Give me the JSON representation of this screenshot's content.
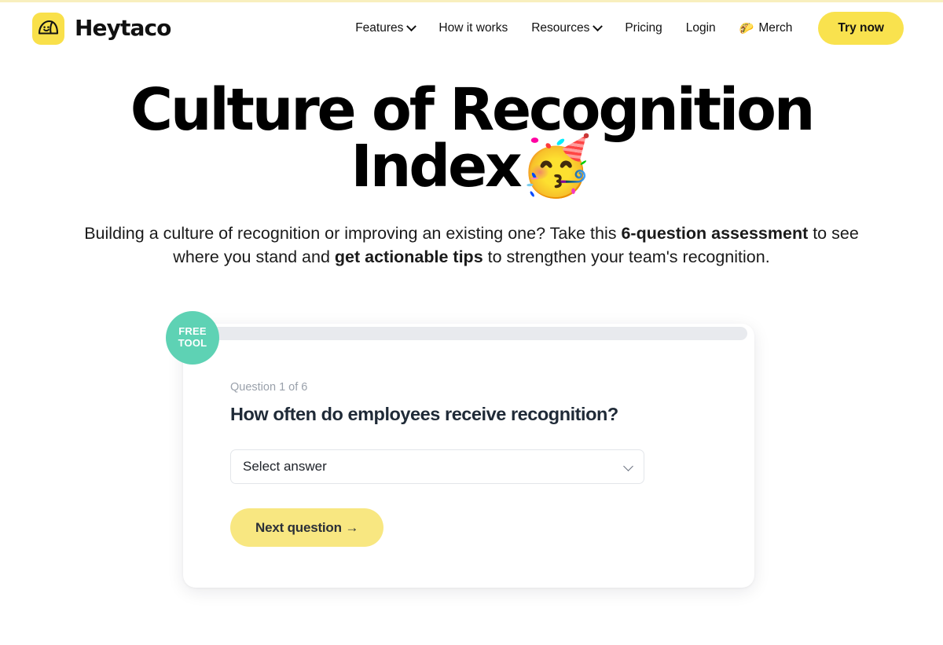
{
  "header": {
    "brand": {
      "name": "Heytaco",
      "logo_icon": "taco-smiley-icon",
      "logo_bg": "#f9e04a"
    },
    "nav": [
      {
        "label": "Features",
        "has_dropdown": true
      },
      {
        "label": "How it works",
        "has_dropdown": false
      },
      {
        "label": "Resources",
        "has_dropdown": true
      },
      {
        "label": "Pricing",
        "has_dropdown": false
      },
      {
        "label": "Login",
        "has_dropdown": false
      },
      {
        "label": "Merch",
        "emoji": "🌮",
        "has_dropdown": false
      }
    ],
    "cta_label": "Try now",
    "cta_color": "#f9e24e",
    "top_rule_color": "#f8efbe"
  },
  "hero": {
    "title_line1": "Culture of Recognition",
    "title_line2": "Index",
    "title_emoji": "🥳",
    "sub_part1": "Building a culture of recognition or improving an existing one? Take this ",
    "sub_bold1": "6-question assessment",
    "sub_part2": " to see where you stand and ",
    "sub_bold2": "get actionable tips",
    "sub_part3": " to strengthen your team's recognition."
  },
  "quiz": {
    "badge_line1": "FREE",
    "badge_line2": "TOOL",
    "badge_color": "#5ed2b4",
    "progress_percent": 0,
    "progress_track_color": "#e8eaee",
    "counter": "Question 1 of 6",
    "question": "How often do employees receive recognition?",
    "select_value": "Select answer",
    "select_chevron_icon": "chevron-down-icon",
    "next_label": "Next question →",
    "next_color": "#f8e781"
  }
}
